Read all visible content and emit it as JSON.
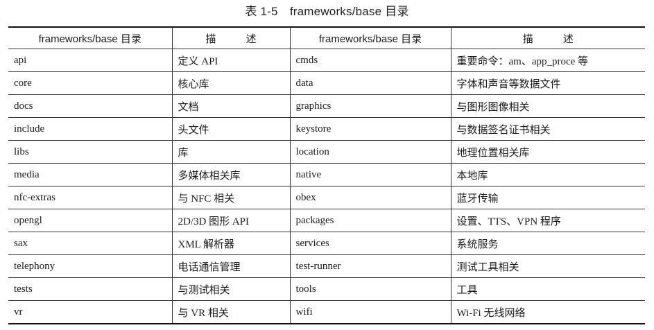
{
  "caption": "表 1-5　frameworks/base 目录",
  "headers": [
    "frameworks/base 目录",
    "描　述",
    "frameworks/base 目录",
    "描　述"
  ],
  "rows": [
    [
      "api",
      "定义 API",
      "cmds",
      "重要命令：am、app_proce 等"
    ],
    [
      "core",
      "核心库",
      "data",
      "字体和声音等数据文件"
    ],
    [
      "docs",
      "文档",
      "graphics",
      "与图形图像相关"
    ],
    [
      "include",
      "头文件",
      "keystore",
      "与数据签名证书相关"
    ],
    [
      "libs",
      "库",
      "location",
      "地理位置相关库"
    ],
    [
      "media",
      "多媒体相关库",
      "native",
      "本地库"
    ],
    [
      "nfc-extras",
      "与 NFC 相关",
      "obex",
      "蓝牙传输"
    ],
    [
      "opengl",
      "2D/3D 图形 API",
      "packages",
      "设置、TTS、VPN 程序"
    ],
    [
      "sax",
      "XML 解析器",
      "services",
      "系统服务"
    ],
    [
      "telephony",
      "电话通信管理",
      "test-runner",
      "测试工具相关"
    ],
    [
      "tests",
      "与测试相关",
      "tools",
      "工具"
    ],
    [
      "vr",
      "与 VR 相关",
      "wifi",
      "Wi-Fi 无线网络"
    ]
  ]
}
